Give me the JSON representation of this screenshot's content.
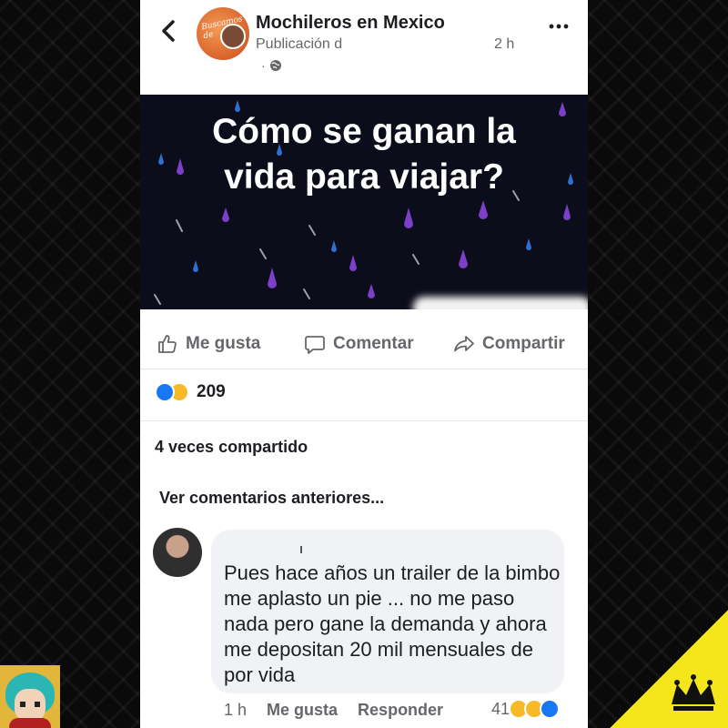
{
  "header": {
    "page_name": "Mochileros en Mexico",
    "post_meta": "Publicación d",
    "post_time": "2 h",
    "privacy_dot": "·",
    "avatar_text": "Buscamos de"
  },
  "post": {
    "image_text_line1": "Cómo se ganan la",
    "image_text_line2": "vida para viajar?"
  },
  "actions": {
    "like_label": "Me gusta",
    "comment_label": "Comentar",
    "share_label": "Compartir"
  },
  "stats": {
    "reaction_count": "209",
    "shares_text": "4 veces compartido",
    "previous_comments_label": "Ver comentarios anteriores..."
  },
  "comment": {
    "commenter_name": "",
    "text": "Pues hace años un trailer de la bimbo me aplasto un pie ... no me paso nada pero gane la demanda y ahora me depositan 20 mil mensuales de por vida",
    "time": "1 h",
    "like_label": "Me gusta",
    "reply_label": "Responder",
    "reaction_count": "41"
  },
  "colors": {
    "accent_blue": "#1877f2",
    "reaction_yellow": "#f7b928",
    "badge_yellow": "#f5e51b",
    "image_bg": "#0c0d1a"
  },
  "icons": [
    "back-icon",
    "more-icon",
    "globe-icon",
    "like-icon",
    "comment-icon",
    "share-icon",
    "crown-icon"
  ]
}
